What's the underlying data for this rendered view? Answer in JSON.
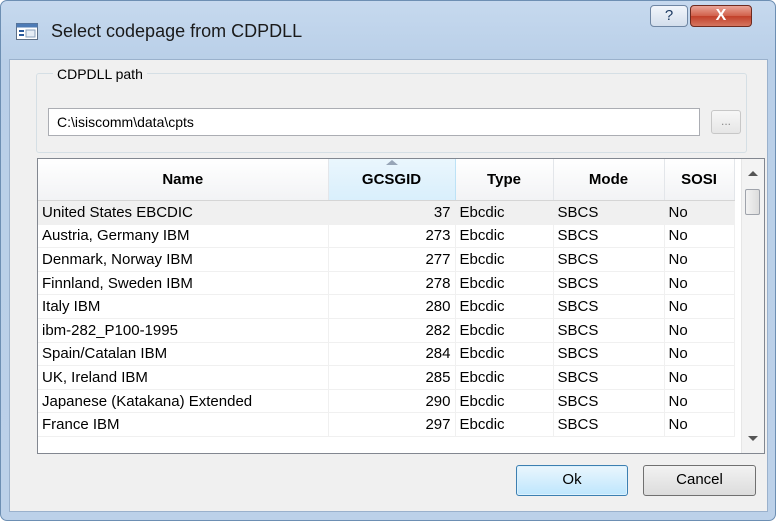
{
  "window": {
    "title": "Select codepage from CDPDLL",
    "help_label": "?",
    "close_label": "X"
  },
  "path_group": {
    "label": "CDPDLL path",
    "value": "C:\\isiscomm\\data\\cpts",
    "browse_label": "..."
  },
  "table": {
    "columns": [
      "Name",
      "GCSGID",
      "Type",
      "Mode",
      "SOSI"
    ],
    "sorted_column": "GCSGID",
    "rows": [
      [
        "United States EBCDIC",
        "37",
        "Ebcdic",
        "SBCS",
        "No"
      ],
      [
        "Austria, Germany IBM",
        "273",
        "Ebcdic",
        "SBCS",
        "No"
      ],
      [
        "Denmark, Norway IBM",
        "277",
        "Ebcdic",
        "SBCS",
        "No"
      ],
      [
        "Finnland, Sweden IBM",
        "278",
        "Ebcdic",
        "SBCS",
        "No"
      ],
      [
        "Italy IBM",
        "280",
        "Ebcdic",
        "SBCS",
        "No"
      ],
      [
        "ibm-282_P100-1995",
        "282",
        "Ebcdic",
        "SBCS",
        "No"
      ],
      [
        "Spain/Catalan IBM",
        "284",
        "Ebcdic",
        "SBCS",
        "No"
      ],
      [
        "UK, Ireland IBM",
        "285",
        "Ebcdic",
        "SBCS",
        "No"
      ],
      [
        "Japanese (Katakana) Extended",
        "290",
        "Ebcdic",
        "SBCS",
        "No"
      ],
      [
        "France IBM",
        "297",
        "Ebcdic",
        "SBCS",
        "No"
      ]
    ]
  },
  "buttons": {
    "ok": "Ok",
    "cancel": "Cancel"
  }
}
